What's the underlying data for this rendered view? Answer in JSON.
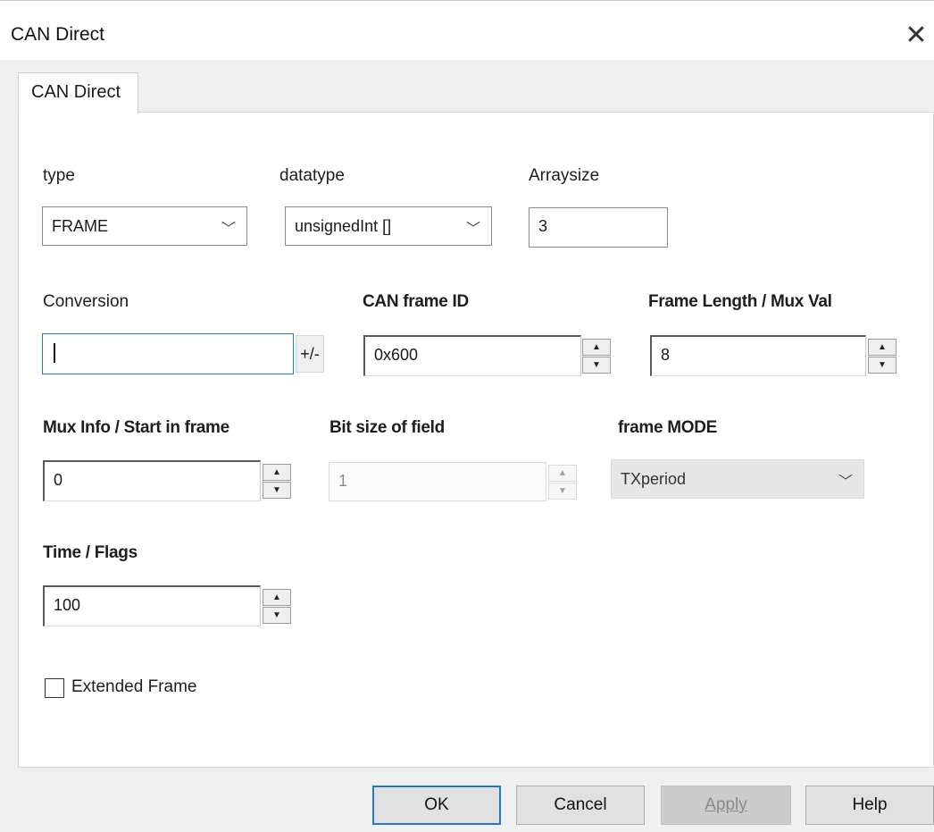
{
  "window": {
    "title": "CAN Direct"
  },
  "tabs": [
    {
      "label": "CAN Direct"
    }
  ],
  "fields": {
    "type": {
      "label": "type",
      "value": "FRAME"
    },
    "datatype": {
      "label": "datatype",
      "value": "unsignedInt []"
    },
    "arraysize": {
      "label": "Arraysize",
      "value": "3"
    },
    "conversion": {
      "label": "Conversion",
      "value": "",
      "toggle_label": "+/-"
    },
    "can_frame_id": {
      "label": "CAN frame ID",
      "value": "0x600"
    },
    "frame_length": {
      "label": "Frame Length / Mux Val",
      "value": "8"
    },
    "mux_info": {
      "label": "Mux Info / Start in frame",
      "value": "0"
    },
    "bit_size": {
      "label": "Bit size of field",
      "value": "1"
    },
    "frame_mode": {
      "label": "frame MODE",
      "value": "TXperiod"
    },
    "time_flags": {
      "label": "Time / Flags",
      "value": "100"
    }
  },
  "extended_frame": {
    "label": "Extended Frame",
    "checked": false
  },
  "buttons": {
    "ok": "OK",
    "cancel": "Cancel",
    "apply": "Apply",
    "help": "Help"
  },
  "icons": {
    "close": "close-icon",
    "chevron": "chevron-down-icon",
    "spin_up": "arrow-up-icon",
    "spin_down": "arrow-down-icon"
  },
  "colors": {
    "focus_accent": "#1f78d1"
  }
}
